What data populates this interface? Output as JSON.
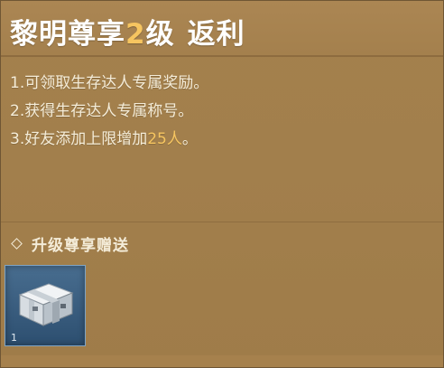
{
  "header": {
    "title_prefix": "黎明尊享",
    "title_level": "2",
    "title_mid": "级",
    "title_suffix": "返利",
    "accent_color": "#f6c560"
  },
  "benefits": [
    {
      "text": "1.可领取生存达人专属奖励。"
    },
    {
      "text": "2.获得生存达人专属称号。"
    },
    {
      "prefix": "3.好友添加上限增加",
      "highlight": "25人",
      "suffix": "。"
    }
  ],
  "gift_section": {
    "title": "升级尊享赠送",
    "bullet_icon": "diamond-bullet-icon"
  },
  "reward_items": [
    {
      "icon": "supply-crate-icon",
      "count": "1",
      "slot_color": "#3a5f82"
    }
  ],
  "colors": {
    "panel_background": "#a27f4c",
    "text": "#f4ecd8",
    "highlight": "#f6c560"
  }
}
